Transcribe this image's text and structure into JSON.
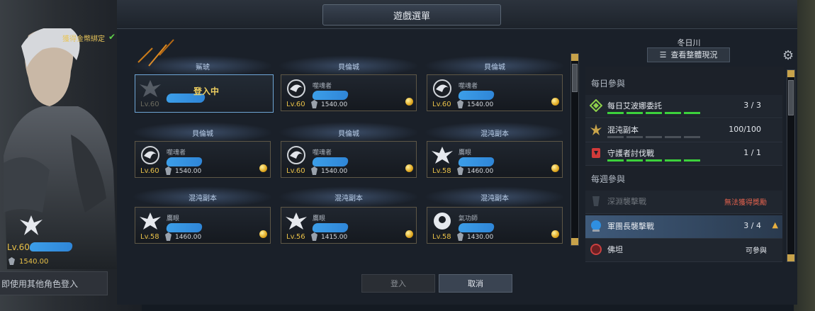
{
  "window": {
    "title": "遊戲選單",
    "region": "冬日川",
    "overview_button": "查看整體現況",
    "overview_icon": "list-icon",
    "settings_icon": "gear-icon"
  },
  "hero": {
    "bound_label": "獲得金幣綁定",
    "check_icon": "check-icon",
    "level": "Lv.60",
    "gold": "1540.00",
    "other_login": "即使用其他角色登入"
  },
  "characters": [
    {
      "location": "鯊琥",
      "class": "",
      "level": "Lv.60",
      "item_level": "",
      "status": "登入中",
      "selected": true
    },
    {
      "location": "貝倫城",
      "class": "噬魂者",
      "level": "Lv.60",
      "item_level": "1540.00"
    },
    {
      "location": "貝倫城",
      "class": "噬魂者",
      "level": "Lv.60",
      "item_level": "1540.00"
    },
    {
      "location": "貝倫城",
      "class": "噬魂者",
      "level": "Lv.60",
      "item_level": "1540.00"
    },
    {
      "location": "貝倫城",
      "class": "噬魂者",
      "level": "Lv.60",
      "item_level": "1540.00"
    },
    {
      "location": "混沌副本",
      "class": "鷹眼",
      "level": "Lv.58",
      "item_level": "1460.00"
    },
    {
      "location": "混沌副本",
      "class": "鷹眼",
      "level": "Lv.58",
      "item_level": "1460.00"
    },
    {
      "location": "混沌副本",
      "class": "鷹眼",
      "level": "Lv.56",
      "item_level": "1415.00"
    },
    {
      "location": "混沌副本",
      "class": "氣功師",
      "level": "Lv.58",
      "item_level": "1430.00"
    }
  ],
  "buttons": {
    "login": "登入",
    "cancel": "取消"
  },
  "daily": {
    "heading": "每日參與",
    "items": [
      {
        "name": "每日艾波娜委託",
        "count": "3 / 3",
        "progress": 1.0,
        "icon": "diamond-quest-icon",
        "color": "#8ed14a"
      },
      {
        "name": "混沌副本",
        "count": "100/100",
        "progress": 0.0,
        "icon": "chaos-icon",
        "color": "#c9a44a"
      },
      {
        "name": "守護者討伐戰",
        "count": "1 / 1",
        "progress": 1.0,
        "icon": "guardian-icon",
        "color": "#d13a3a"
      }
    ]
  },
  "weekly": {
    "heading": "每週參與",
    "items": [
      {
        "name": "深淵襲擊戰",
        "note": "無法獲得獎勵",
        "icon": "abyss-icon",
        "dim": true
      },
      {
        "name": "軍團長襲擊戰",
        "count": "3 / 4",
        "icon": "legion-icon",
        "highlight": true
      },
      {
        "name": "佛坦",
        "note": "可參與",
        "icon": "fotan-icon"
      }
    ]
  },
  "colors": {
    "accent_gold": "#e8c048",
    "progress_on": "#3cd13c",
    "warn": "#e0614d"
  }
}
